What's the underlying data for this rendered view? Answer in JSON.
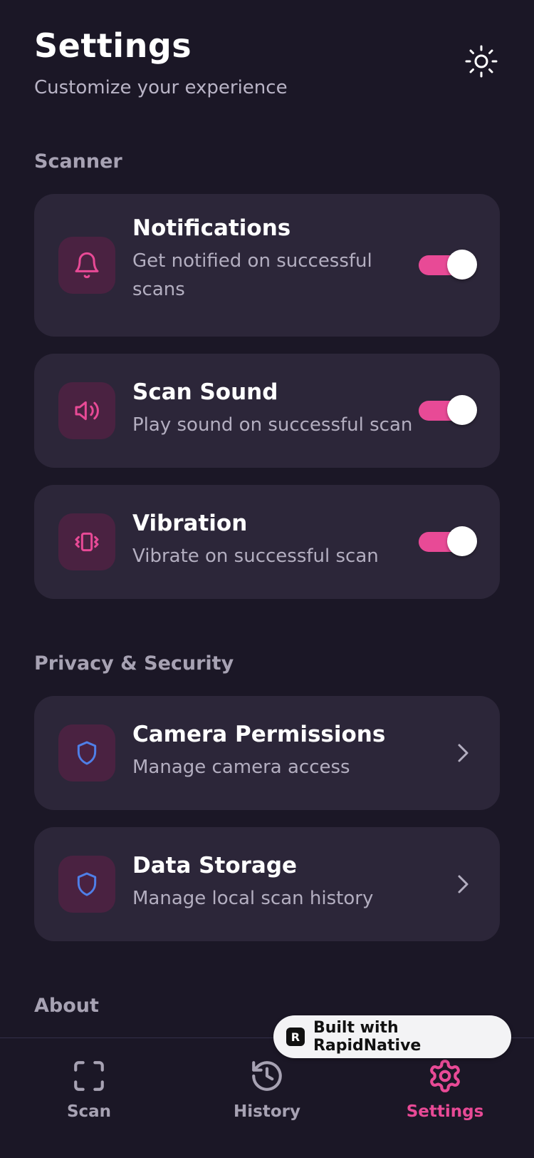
{
  "header": {
    "title": "Settings",
    "subtitle": "Customize your experience",
    "theme_icon": "sun-icon"
  },
  "sections": {
    "scanner": "Scanner",
    "privacy": "Privacy & Security",
    "about": "About"
  },
  "scanner_items": [
    {
      "title": "Notifications",
      "desc_line1": "Get notified on successful",
      "desc_line2": "scans",
      "icon": "bell-icon",
      "enabled": true
    },
    {
      "title": "Scan Sound",
      "desc": "Play sound on successful scan",
      "icon": "speaker-icon",
      "enabled": true
    },
    {
      "title": "Vibration",
      "desc": "Vibrate on successful scan",
      "icon": "vibration-icon",
      "enabled": true
    }
  ],
  "privacy_items": [
    {
      "title": "Camera Permissions",
      "desc": "Manage camera access",
      "icon": "shield-icon"
    },
    {
      "title": "Data Storage",
      "desc": "Manage local scan history",
      "icon": "shield-icon"
    }
  ],
  "tabs": [
    {
      "label": "Scan",
      "icon": "scan-icon",
      "active": false
    },
    {
      "label": "History",
      "icon": "history-icon",
      "active": false
    },
    {
      "label": "Settings",
      "icon": "gear-icon",
      "active": true
    }
  ],
  "badge": {
    "logo": "R",
    "text": "Built with RapidNative"
  },
  "colors": {
    "background": "#1b1726",
    "card": "#2c2639",
    "accent": "#e84a96",
    "icon_box": "#4a2241",
    "shield_blue": "#4f7fe8"
  }
}
